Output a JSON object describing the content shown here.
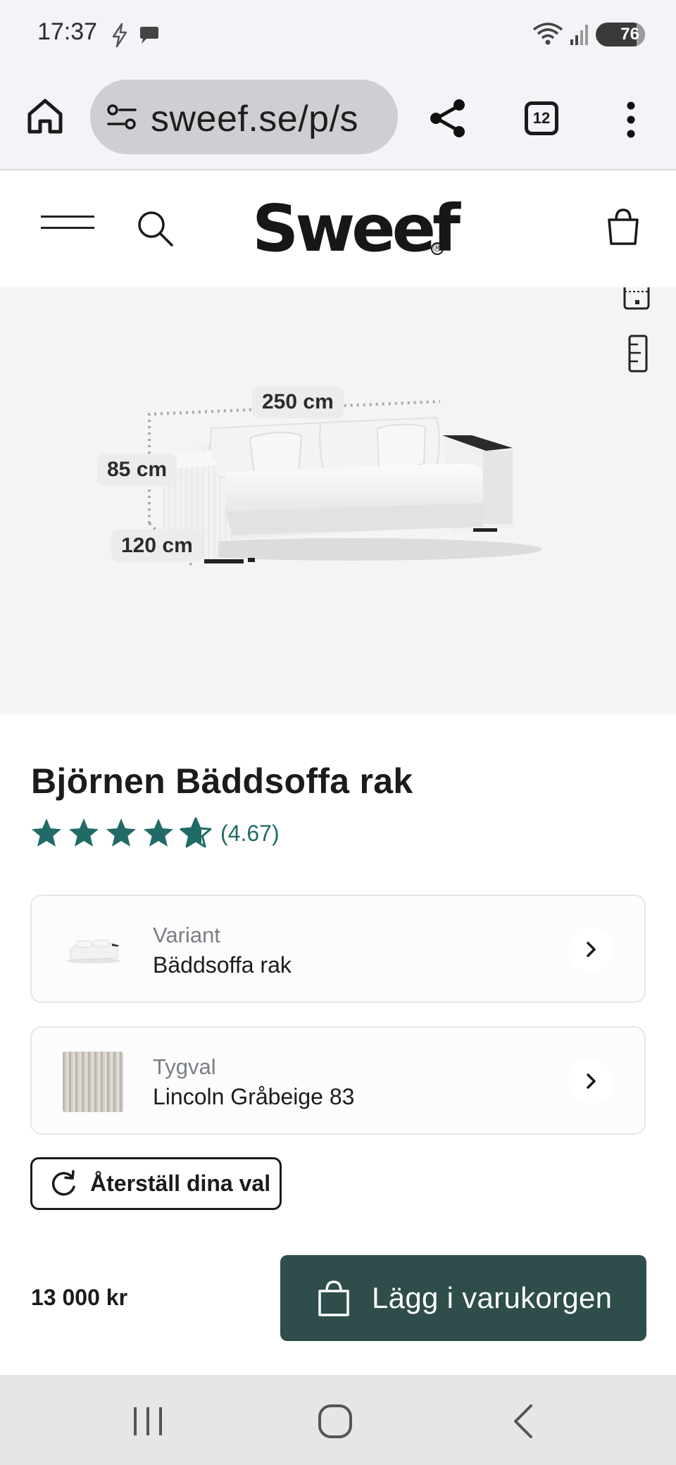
{
  "status_bar": {
    "time": "17:37",
    "battery": "76",
    "icons": [
      "flash-icon",
      "chat-bubble-icon",
      "wifi-icon",
      "signal-icon",
      "battery-icon"
    ]
  },
  "browser": {
    "url": "sweef.se/p/s",
    "tab_count": "12",
    "icons": [
      "home-icon",
      "site-settings-icon",
      "share-icon",
      "tabs-icon",
      "more-vertical-icon"
    ]
  },
  "header": {
    "logo_text": "Sweef",
    "logo_mark": "®",
    "icons": [
      "menu-icon",
      "search-icon",
      "shopping-bag-icon"
    ]
  },
  "hero": {
    "dimensions": {
      "width": "250 cm",
      "height": "85 cm",
      "depth": "120 cm"
    },
    "tools": [
      "calendar-icon",
      "ruler-icon"
    ]
  },
  "product": {
    "title": "Björnen Bäddsoffa rak",
    "rating": "(4.67)",
    "rating_value": 4.67,
    "rating_max": 5,
    "options": [
      {
        "label": "Variant",
        "value": "Bäddsoffa rak"
      },
      {
        "label": "Tygval",
        "value": "Lincoln Gråbeige 83"
      }
    ],
    "reset_label": "Återställ dina val",
    "price": "13 000 kr",
    "add_to_cart_label": "Lägg i varukorgen"
  },
  "colors": {
    "accent_green": "#2e4d4b",
    "star_teal": "#216b66",
    "hero_background": "#f4f4f4"
  },
  "nav": {
    "icons": [
      "recent-apps-icon",
      "home-circle-icon",
      "back-icon"
    ]
  }
}
